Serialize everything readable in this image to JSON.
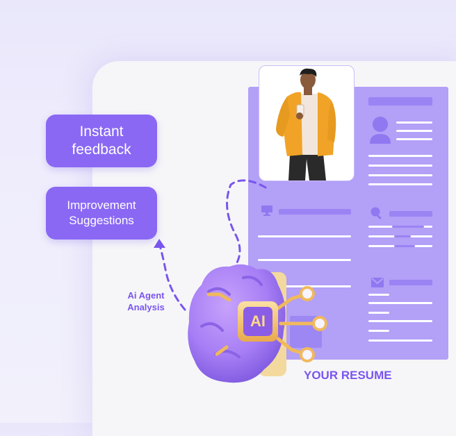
{
  "pills": {
    "instant": "Instant\nfeedback",
    "improvement": "Improvement\nSuggestions"
  },
  "analysis_label": "Ai Agent\nAnalysis",
  "ai_chip_label": "AI",
  "resume_caption": "YOUR RESUME",
  "colors": {
    "accent": "#8a68f4",
    "resume_panel": "#b3a0f7",
    "text_accent": "#7a55ee",
    "brain": "#a77ef5",
    "chip": "#f5c97a"
  },
  "icons": [
    "user-icon",
    "monitor-icon",
    "search-icon",
    "mail-icon",
    "brain-icon",
    "ai-chip-icon",
    "cursor-arrow-icon"
  ]
}
